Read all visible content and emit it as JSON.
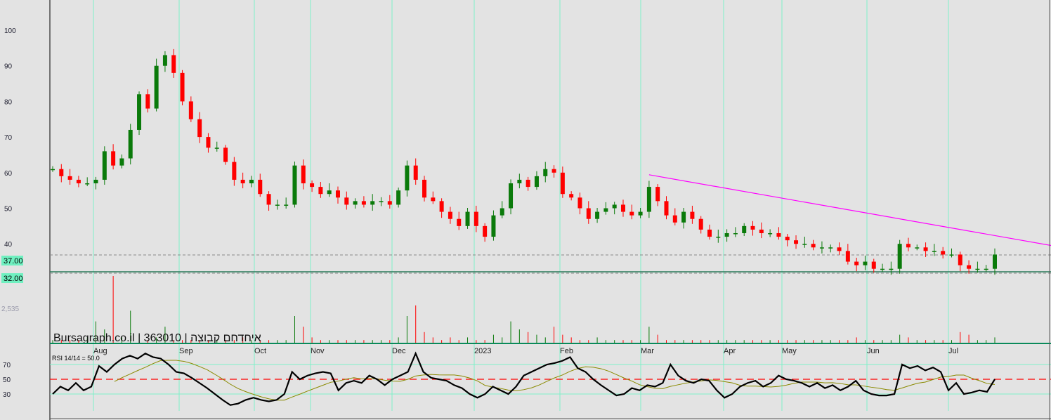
{
  "chart_data": {
    "type": "candlestick",
    "title": "Bursagraph.co.il | 363010 | איחדחם קבוצה",
    "brand": "Bursagraph.co.il",
    "symbol": "363010",
    "name_hebrew": "איחדחם קבוצה",
    "y_ticks": [
      "100",
      "90",
      "80",
      "70",
      "60",
      "50",
      "40"
    ],
    "ylim": [
      32,
      100
    ],
    "price_labels": {
      "current": "37.00",
      "low": "32.00"
    },
    "volume_label": "2,535",
    "months": [
      "Aug",
      "Sep",
      "Oct",
      "Nov",
      "Dec",
      "2023",
      "Feb",
      "Mar",
      "Apr",
      "May",
      "Jun",
      "Jul"
    ],
    "closes": [
      61,
      59,
      58,
      57,
      57,
      58,
      66,
      62,
      64,
      72,
      82,
      78,
      90,
      93,
      88,
      80,
      75,
      70,
      67,
      67,
      63,
      58,
      57,
      58,
      54,
      51,
      51,
      51,
      62,
      57,
      56,
      54,
      55,
      53,
      51,
      52,
      51,
      52,
      52,
      51,
      55,
      62,
      58,
      53,
      52,
      49,
      47,
      45,
      49,
      45,
      42,
      48,
      50,
      57,
      58,
      56,
      59,
      61,
      60,
      54,
      53,
      50,
      47,
      49,
      50,
      51,
      49,
      48,
      49,
      56,
      52,
      48,
      46,
      49,
      47,
      44,
      42,
      42,
      43,
      43,
      45,
      44,
      43,
      43,
      42,
      41,
      40,
      40,
      39,
      39,
      39,
      38,
      35,
      34,
      35,
      33,
      33,
      33,
      40,
      39,
      39,
      38,
      38,
      37,
      37,
      34,
      33,
      33,
      33,
      37
    ],
    "volume": [
      1,
      1,
      1,
      1,
      2,
      8,
      5,
      25,
      2,
      12,
      3,
      1,
      2,
      6,
      1,
      1,
      1,
      1,
      1,
      1,
      1,
      1,
      2,
      1,
      1,
      1,
      1,
      1,
      10,
      6,
      2,
      1,
      1,
      1,
      1,
      1,
      1,
      1,
      1,
      1,
      2,
      10,
      14,
      4,
      2,
      1,
      2,
      1,
      2,
      1,
      1,
      3,
      2,
      8,
      5,
      4,
      3,
      2,
      6,
      3,
      2,
      1,
      1,
      2,
      1,
      1,
      1,
      1,
      1,
      6,
      3,
      1,
      1,
      1,
      1,
      1,
      1,
      1,
      1,
      1,
      1,
      1,
      1,
      1,
      1,
      1,
      1,
      1,
      1,
      1,
      1,
      1,
      1,
      2,
      1,
      1,
      1,
      1,
      3,
      2,
      1,
      1,
      1,
      1,
      1,
      4,
      3,
      1,
      1,
      2
    ],
    "trendline": {
      "start_index": 69,
      "start_price": 59.4,
      "end_index": 125,
      "end_price": 35.5,
      "color": "#ff00ff"
    },
    "rsi": {
      "label": "RSI 14/14 = 50.0",
      "ticks": [
        "70",
        "50",
        "30"
      ],
      "values": [
        30,
        40,
        35,
        45,
        35,
        40,
        68,
        60,
        70,
        78,
        82,
        78,
        85,
        80,
        78,
        70,
        60,
        58,
        52,
        45,
        38,
        30,
        22,
        15,
        17,
        22,
        25,
        22,
        20,
        22,
        30,
        60,
        50,
        55,
        58,
        60,
        58,
        35,
        45,
        48,
        45,
        55,
        50,
        42,
        50,
        55,
        60,
        85,
        60,
        52,
        50,
        48,
        42,
        38,
        30,
        25,
        30,
        40,
        35,
        30,
        40,
        55,
        60,
        65,
        70,
        72,
        75,
        80,
        65,
        60,
        50,
        42,
        35,
        28,
        30,
        38,
        35,
        42,
        40,
        45,
        70,
        55,
        48,
        45,
        50,
        48,
        35,
        25,
        30,
        40,
        45,
        48,
        40,
        45,
        55,
        50,
        48,
        45,
        40,
        45,
        38,
        42,
        35,
        40,
        48,
        35,
        30,
        28,
        28,
        30,
        70,
        65,
        68,
        62,
        66,
        60,
        35,
        45,
        30,
        32,
        35,
        33,
        50
      ]
    },
    "colors": {
      "up": "#0a7a0a",
      "down": "#ff0000",
      "grid": "#7ff0c8",
      "rsi_mid": "#ff0000",
      "rsi_ma": "#8a8a00"
    }
  }
}
